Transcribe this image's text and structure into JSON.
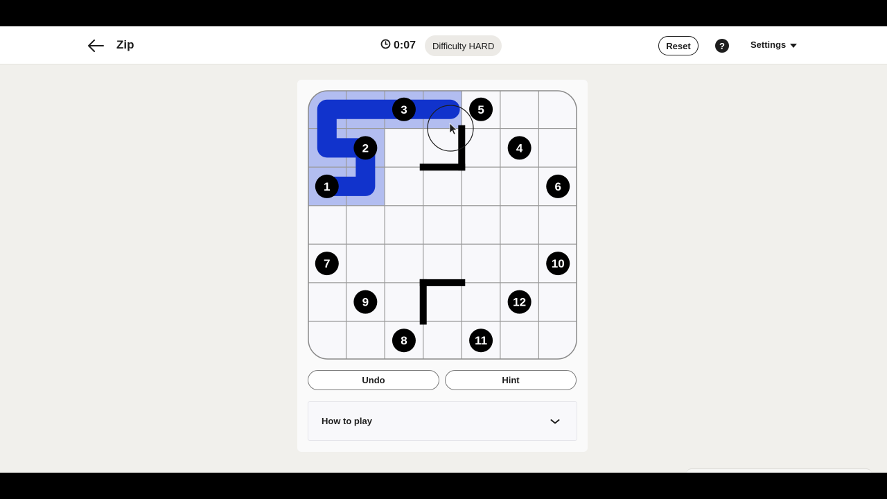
{
  "header": {
    "title": "Zip",
    "timer": "0:07",
    "difficulty": "Difficulty HARD",
    "reset_label": "Reset",
    "help_label": "?",
    "settings_label": "Settings"
  },
  "colors": {
    "page_bg": "#f1f0ec",
    "path": "#1133cc",
    "path_fill": "#b2bdf0",
    "wall": "#000000",
    "cell_bg": "#f8f8fb",
    "grid_line": "#9a9a9a"
  },
  "board": {
    "rows": 7,
    "cols": 7,
    "numbers": [
      {
        "label": "3",
        "row": 0,
        "col": 2
      },
      {
        "label": "5",
        "row": 0,
        "col": 4
      },
      {
        "label": "2",
        "row": 1,
        "col": 1
      },
      {
        "label": "4",
        "row": 1,
        "col": 5
      },
      {
        "label": "1",
        "row": 2,
        "col": 0
      },
      {
        "label": "6",
        "row": 2,
        "col": 6
      },
      {
        "label": "7",
        "row": 4,
        "col": 0
      },
      {
        "label": "10",
        "row": 4,
        "col": 6
      },
      {
        "label": "9",
        "row": 5,
        "col": 1
      },
      {
        "label": "12",
        "row": 5,
        "col": 5
      },
      {
        "label": "8",
        "row": 6,
        "col": 2
      },
      {
        "label": "11",
        "row": 6,
        "col": 4
      }
    ],
    "filled_cells": [
      [
        0,
        0
      ],
      [
        0,
        1
      ],
      [
        0,
        2
      ],
      [
        0,
        3
      ],
      [
        1,
        0
      ],
      [
        1,
        1
      ],
      [
        2,
        0
      ],
      [
        2,
        1
      ]
    ],
    "path": [
      [
        2,
        0
      ],
      [
        2,
        1
      ],
      [
        1,
        1
      ],
      [
        1,
        0
      ],
      [
        0,
        0
      ],
      [
        0,
        1
      ],
      [
        0,
        2
      ],
      [
        0,
        3
      ]
    ],
    "walls": [
      {
        "row": 1,
        "col": 3,
        "side": "right"
      },
      {
        "row": 1,
        "col": 3,
        "side": "bottom"
      },
      {
        "row": 5,
        "col": 3,
        "side": "left"
      },
      {
        "row": 5,
        "col": 3,
        "side": "top"
      }
    ]
  },
  "actions": {
    "undo_label": "Undo",
    "hint_label": "Hint"
  },
  "how_to_play": {
    "label": "How to play"
  }
}
